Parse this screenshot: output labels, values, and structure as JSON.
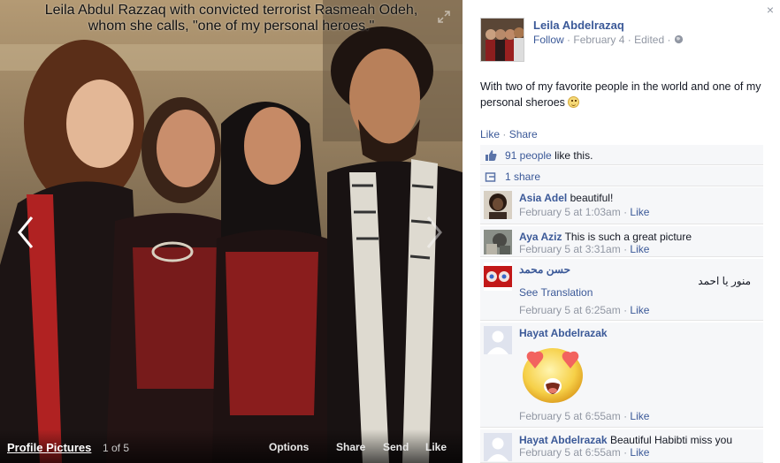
{
  "viewer": {
    "caption_line1": "Leila Abdul Razzaq with convicted terrorist Rasmeah Odeh,",
    "caption_line2": "whom she calls, \"one of my personal heroes.\"",
    "album_name": "Profile Pictures",
    "photo_count": "1 of 5",
    "actions": {
      "options": "Options",
      "share": "Share",
      "send": "Send",
      "like": "Like"
    },
    "icons": {
      "prev": "chevron-left-icon",
      "next": "chevron-right-icon",
      "expand": "expand-icon"
    }
  },
  "post": {
    "author": "Leila Abdelrazaq",
    "follow": "Follow",
    "date": "February 4",
    "edited": "Edited",
    "text": "With two of my favorite people in the world and one of my personal sheroes",
    "like_label": "Like",
    "share_label": "Share",
    "likes_count": "91 people",
    "likes_suffix": "like this.",
    "shares": "1 share",
    "close_icon": "×"
  },
  "comments": [
    {
      "author": "Asia Adel",
      "text": "beautiful!",
      "time": "February 5 at 1:03am",
      "like": "Like"
    },
    {
      "author": "Aya Aziz",
      "text": "This is such a great picture",
      "time": "February 5 at 3:31am",
      "like": "Like"
    },
    {
      "author": "حسن محمد",
      "text": "منور يا احمد",
      "translate": "See Translation",
      "time": "February 5 at 6:25am",
      "like": "Like"
    },
    {
      "author": "Hayat Abdelrazak",
      "text": "",
      "time": "February 5 at 6:55am",
      "like": "Like"
    },
    {
      "author": "Hayat Abdelrazak",
      "text": "Beautiful Habibti miss you",
      "time": "February 5 at 6:55am",
      "like": "Like"
    }
  ],
  "colors": {
    "link": "#3b5998",
    "meta": "#9197a3",
    "ufi_bg": "#f6f7f9"
  }
}
